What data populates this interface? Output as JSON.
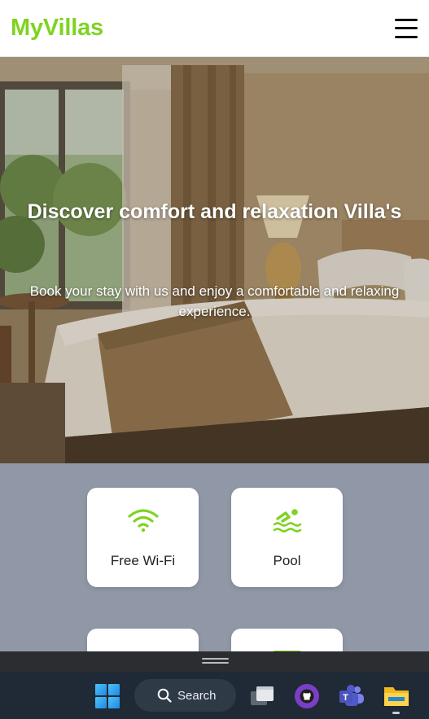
{
  "header": {
    "logo": "MyVillas",
    "menu_icon": "hamburger-menu-icon"
  },
  "hero": {
    "title": "Discover comfort and relaxation Villa's",
    "subtitle": "Book your stay with us and enjoy a comfortable and relaxing experience."
  },
  "amenities": [
    {
      "label": "Free Wi-Fi",
      "icon": "wifi-icon"
    },
    {
      "label": "Pool",
      "icon": "pool-icon"
    },
    {
      "label": "",
      "icon": "amenity-icon"
    },
    {
      "label": "",
      "icon": "amenity-icon"
    }
  ],
  "taskbar": {
    "search_label": "Search",
    "items": [
      "windows-start-icon",
      "search-icon",
      "task-view-icon",
      "github-desktop-icon",
      "teams-icon",
      "file-explorer-icon"
    ]
  },
  "colors": {
    "brand": "#7ed321",
    "amenities_bg": "#9097a6",
    "taskbar_bg": "#1f2a36"
  }
}
